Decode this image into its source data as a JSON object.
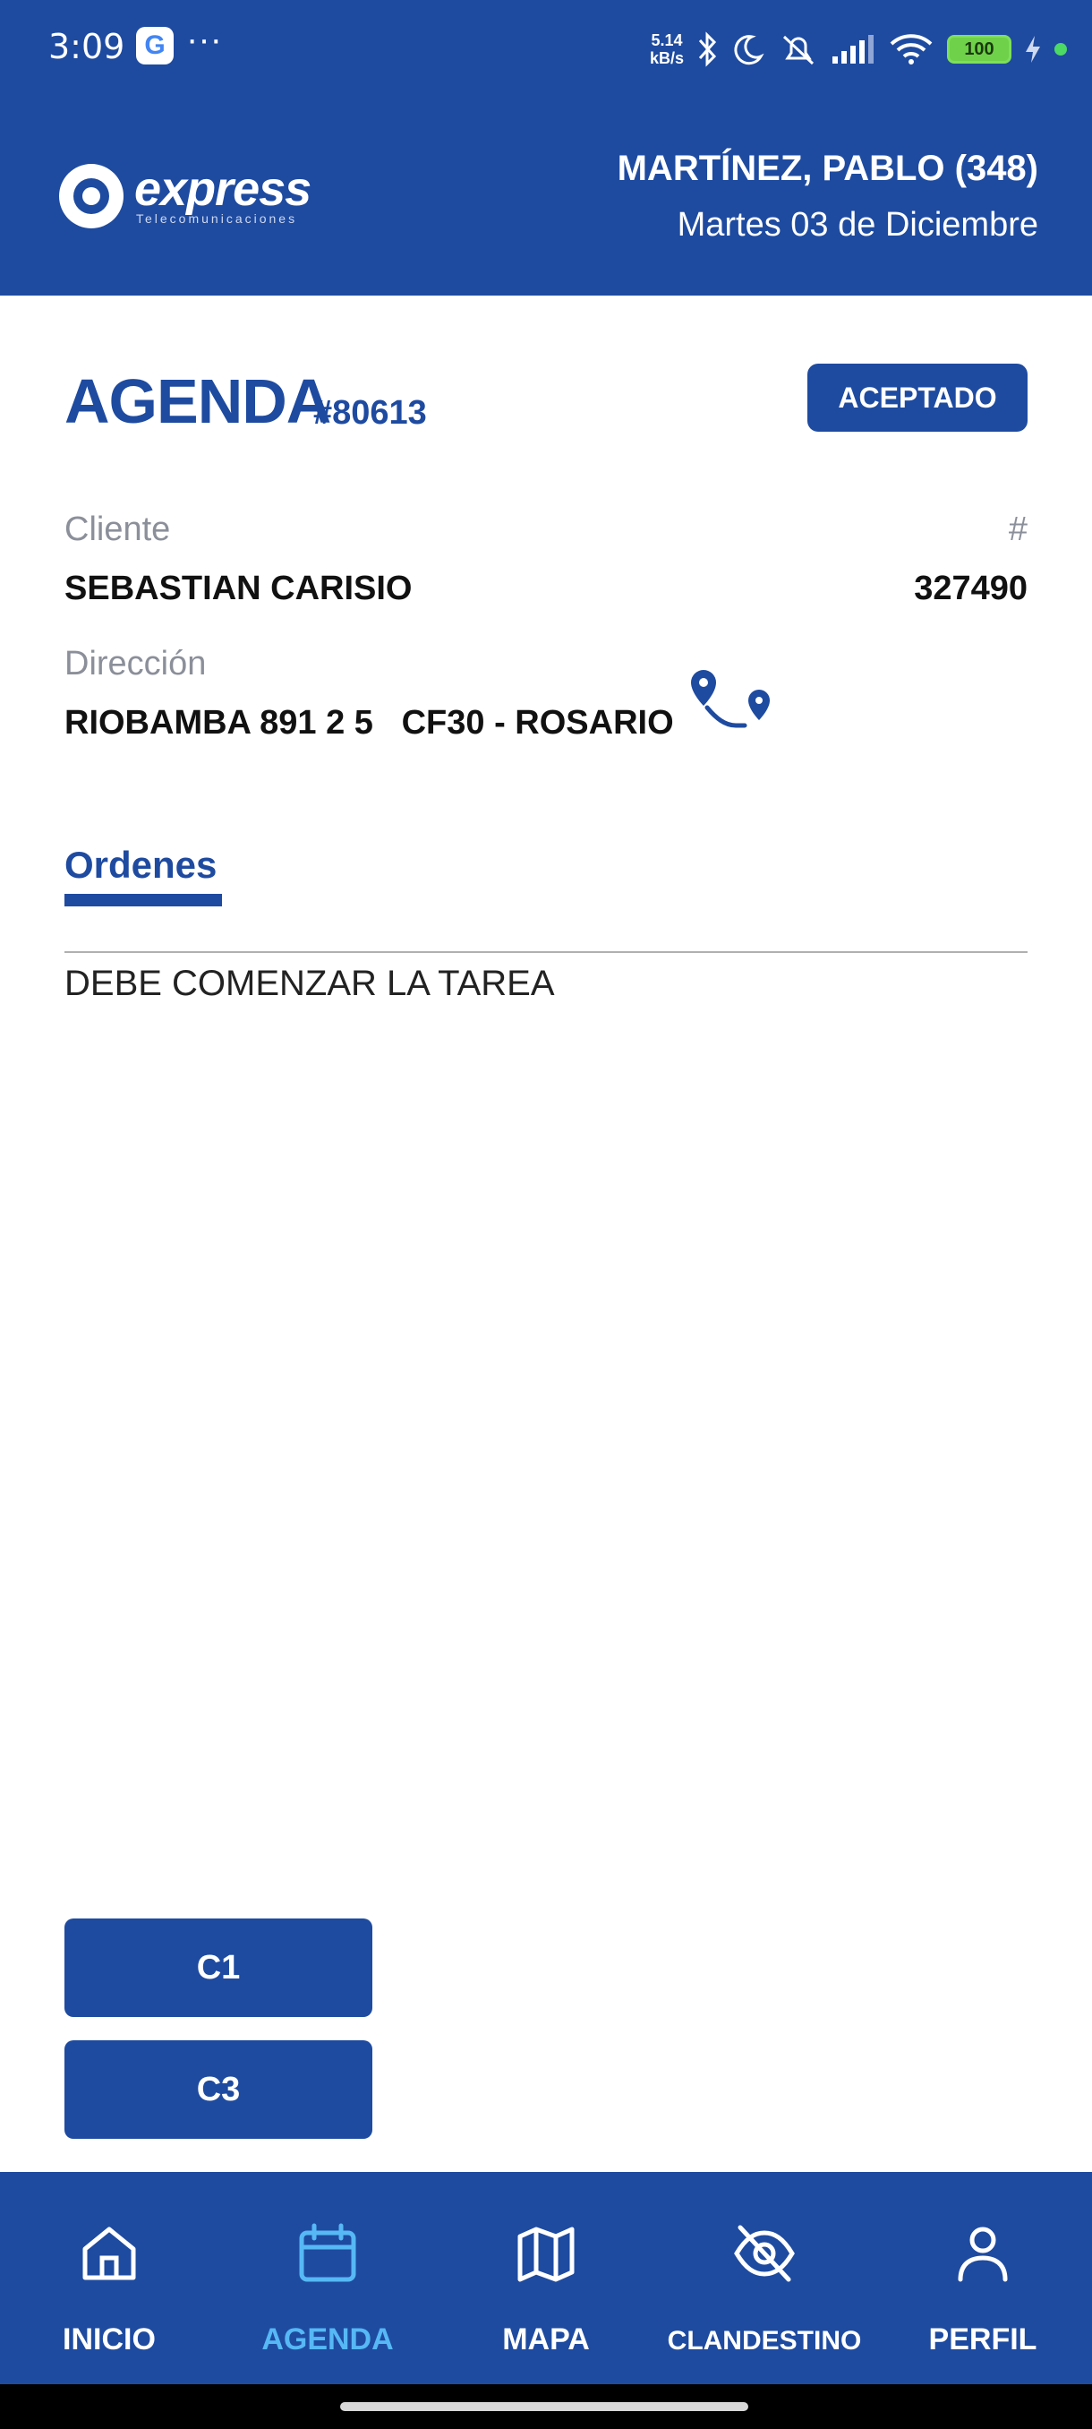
{
  "status_bar": {
    "time": "3:09",
    "dots": "···",
    "network_speed_value": "5.14",
    "network_speed_unit": "kB/s",
    "battery": "100"
  },
  "header": {
    "logo_text": "express",
    "logo_subtext": "Telecomunicaciones",
    "user_name": "MARTÍNEZ, PABLO (348)",
    "date": "Martes 03 de Diciembre"
  },
  "agenda": {
    "title": "AGENDA",
    "number": "#80613",
    "status": "ACEPTADO"
  },
  "client": {
    "label": "Cliente",
    "name": "SEBASTIAN CARISIO",
    "id_label": "#",
    "id_value": "327490"
  },
  "address": {
    "label": "Dirección",
    "value": "RIOBAMBA 891 2 5   CF30 - ROSARIO"
  },
  "orders": {
    "tab_label": "Ordenes",
    "message": "DEBE COMENZAR LA TAREA"
  },
  "actions": {
    "c1_label": "C1",
    "c3_label": "C3"
  },
  "bottom_nav": {
    "items": [
      {
        "label": "INICIO",
        "icon": "home-icon"
      },
      {
        "label": "AGENDA",
        "icon": "calendar-icon",
        "active": true
      },
      {
        "label": "MAPA",
        "icon": "map-icon"
      },
      {
        "label": "CLANDESTINO",
        "icon": "eye-off-icon"
      },
      {
        "label": "PERFIL",
        "icon": "user-icon"
      }
    ],
    "active_color": "#56b8f5"
  },
  "colors": {
    "brand_blue": "#1e4ba0",
    "label_gray": "#8b8f99"
  }
}
